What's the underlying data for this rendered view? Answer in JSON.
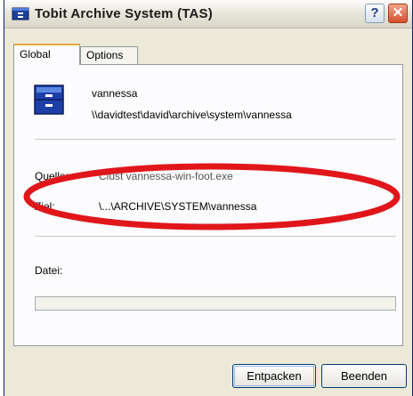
{
  "window": {
    "title": "Tobit Archive System (TAS)",
    "help_glyph": "?",
    "close_glyph": "✕"
  },
  "tabs": [
    {
      "label": "Global",
      "active": true
    },
    {
      "label": "Options",
      "active": false
    }
  ],
  "archive": {
    "name": "vannessa",
    "path": "\\\\davidtest\\david\\archive\\system\\vannessa"
  },
  "fields": {
    "quelle_label": "Quelle:",
    "quelle_value": "Clust vannessa-win-foot.exe",
    "ziel_label": "Ziel:",
    "ziel_value": "\\...\\ARCHIVE\\SYSTEM\\vannessa",
    "datei_label": "Datei:"
  },
  "progress": {
    "fraction": 0
  },
  "buttons": {
    "extract": "Entpacken",
    "exit": "Beenden"
  },
  "colors": {
    "annotation": "#e0161b",
    "tab_highlight": "#e7a839"
  }
}
